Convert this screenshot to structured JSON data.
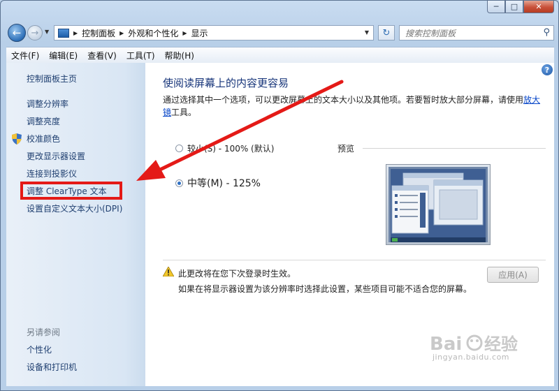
{
  "address": {
    "crumbs": [
      "控制面板",
      "外观和个性化",
      "显示"
    ],
    "search_placeholder": "搜索控制面板"
  },
  "menu": [
    "文件(F)",
    "编辑(E)",
    "查看(V)",
    "工具(T)",
    "帮助(H)"
  ],
  "sidebar": {
    "home": "控制面板主页",
    "links": [
      "调整分辨率",
      "调整亮度",
      "校准颜色",
      "更改显示器设置",
      "连接到投影仪",
      "调整 ClearType 文本",
      "设置自定义文本大小(DPI)"
    ],
    "see_also_title": "另请参阅",
    "see_also": [
      "个性化",
      "设备和打印机"
    ]
  },
  "main": {
    "title": "使阅读屏幕上的内容更容易",
    "desc_prefix": "通过选择其中一个选项，可以更改屏幕上的文本大小以及其他项。若要暂时放大部分屏幕，请使用",
    "desc_link": "放大镜",
    "desc_suffix": "工具。",
    "options": [
      {
        "label": "较小(S) - 100% (默认)",
        "selected": false
      },
      {
        "label": "中等(M) - 125%",
        "selected": true
      }
    ],
    "preview_label": "预览",
    "notice_line1": "此更改将在您下次登录时生效。",
    "notice_line2": "如果在将显示器设置为该分辨率时选择此设置，某些项目可能不适合您的屏幕。",
    "apply_label": "应用(A)"
  },
  "colors": {
    "highlight": "#e41a17",
    "arrow": "#e41a17",
    "link": "#0645c8"
  },
  "watermark": "jingyan.baidu.com"
}
